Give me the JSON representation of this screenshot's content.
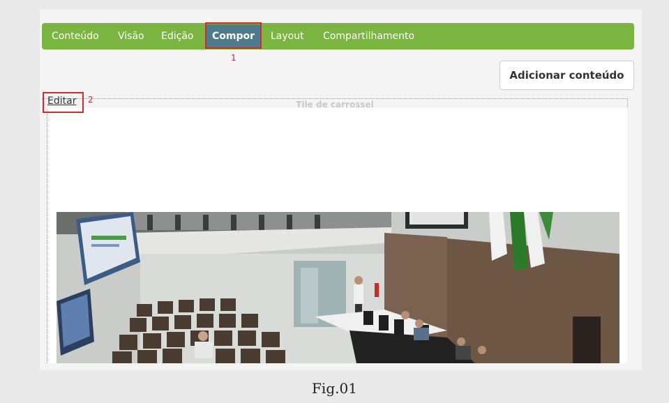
{
  "nav": {
    "items": [
      "Conteúdo",
      "Visão",
      "Edição",
      "Compor",
      "Layout",
      "Compartilhamento"
    ],
    "active": "Compor"
  },
  "markers": {
    "one": "1",
    "two": "2"
  },
  "toolbar": {
    "add_content_label": "Adicionar conteúdo"
  },
  "tile": {
    "edit_label": "Editar",
    "title": "Tile de carrossel"
  },
  "caption": "Fig.01",
  "colors": {
    "navbar": "#7ab542",
    "active_tab": "#4f7a8c",
    "highlight": "#d42a2a"
  }
}
